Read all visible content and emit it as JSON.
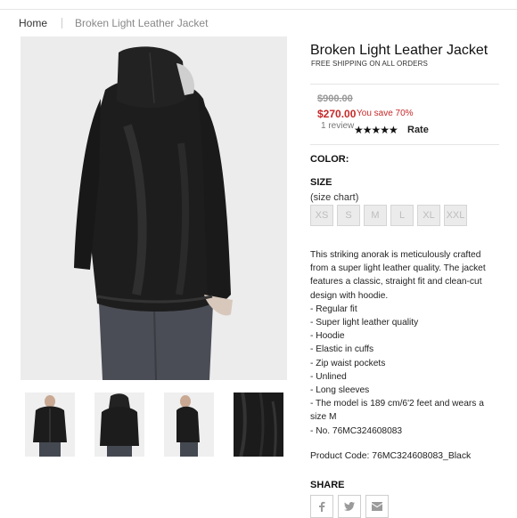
{
  "breadcrumb": {
    "home": "Home",
    "current": "Broken Light Leather Jacket"
  },
  "product": {
    "title": "Broken Light Leather Jacket",
    "shipping": "FREE SHIPPING ON ALL ORDERS",
    "old_price": "$900.00",
    "price": "$270.00",
    "save": "You save 70%",
    "reviews": "1 review",
    "stars": "★★★★★",
    "rate_label": "Rate",
    "color_label": "COLOR:",
    "size_label": "SIZE",
    "size_chart": "(size chart)",
    "sizes": [
      "XS",
      "S",
      "M",
      "L",
      "XL",
      "XXL"
    ],
    "description": "This striking anorak is meticulously crafted from a super light leather quality. The jacket features a classic, straight fit and clean-cut design with hoodie.",
    "features": [
      "- Regular fit",
      "- Super light leather quality",
      "- Hoodie",
      "- Elastic in cuffs",
      "- Zip waist pockets",
      "- Unlined",
      "- Long sleeves",
      "- The model is 189 cm/6'2 feet and wears a size M",
      "- No. 76MC324608083"
    ],
    "product_code": "Product Code: 76MC324608083_Black",
    "share_label": "SHARE"
  },
  "icons": {
    "facebook": "facebook-icon",
    "twitter": "twitter-icon",
    "email": "email-icon"
  },
  "colors": {
    "price_red": "#c62828",
    "muted": "#999999"
  }
}
